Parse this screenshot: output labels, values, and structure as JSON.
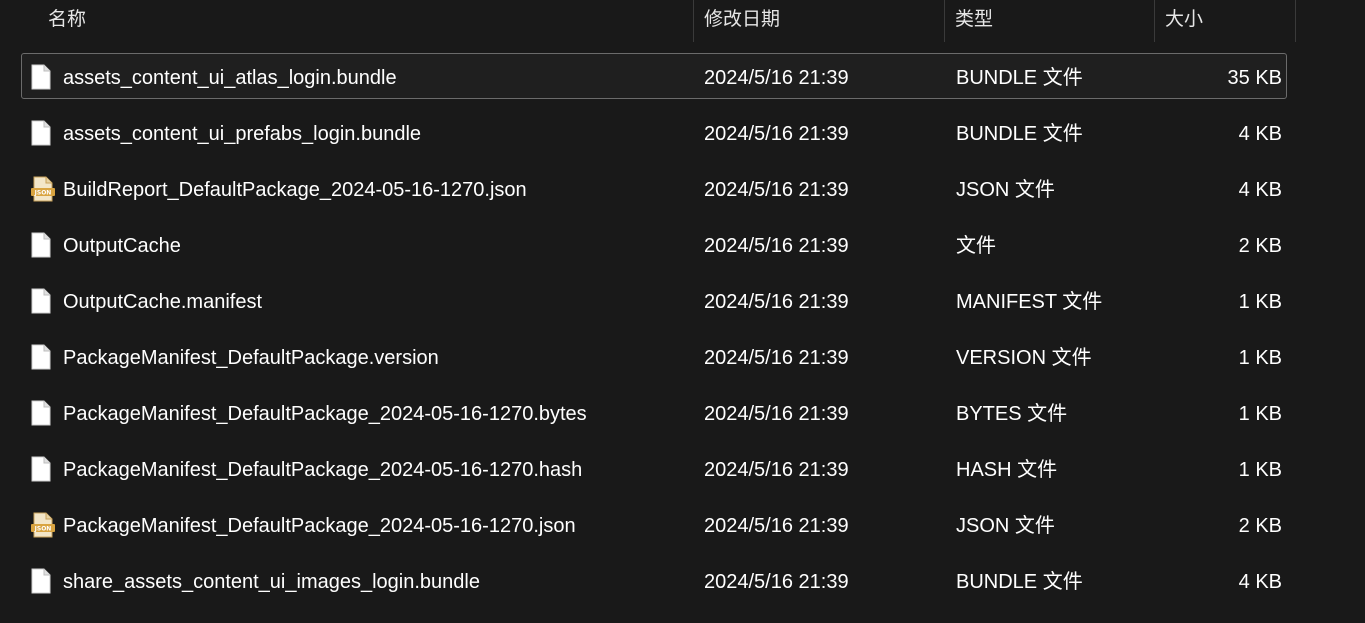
{
  "columns": {
    "name": "名称",
    "date": "修改日期",
    "type": "类型",
    "size": "大小"
  },
  "sort_indicator": "^",
  "files": [
    {
      "name": "assets_content_ui_atlas_login.bundle",
      "date": "2024/5/16 21:39",
      "type": "BUNDLE 文件",
      "size": "35 KB",
      "icon": "generic-file-icon"
    },
    {
      "name": "assets_content_ui_prefabs_login.bundle",
      "date": "2024/5/16 21:39",
      "type": "BUNDLE 文件",
      "size": "4 KB",
      "icon": "generic-file-icon"
    },
    {
      "name": "BuildReport_DefaultPackage_2024-05-16-1270.json",
      "date": "2024/5/16 21:39",
      "type": "JSON 文件",
      "size": "4 KB",
      "icon": "json-file-icon"
    },
    {
      "name": "OutputCache",
      "date": "2024/5/16 21:39",
      "type": "文件",
      "size": "2 KB",
      "icon": "generic-file-icon"
    },
    {
      "name": "OutputCache.manifest",
      "date": "2024/5/16 21:39",
      "type": "MANIFEST 文件",
      "size": "1 KB",
      "icon": "generic-file-icon"
    },
    {
      "name": "PackageManifest_DefaultPackage.version",
      "date": "2024/5/16 21:39",
      "type": "VERSION 文件",
      "size": "1 KB",
      "icon": "generic-file-icon"
    },
    {
      "name": "PackageManifest_DefaultPackage_2024-05-16-1270.bytes",
      "date": "2024/5/16 21:39",
      "type": "BYTES 文件",
      "size": "1 KB",
      "icon": "generic-file-icon"
    },
    {
      "name": "PackageManifest_DefaultPackage_2024-05-16-1270.hash",
      "date": "2024/5/16 21:39",
      "type": "HASH 文件",
      "size": "1 KB",
      "icon": "generic-file-icon"
    },
    {
      "name": "PackageManifest_DefaultPackage_2024-05-16-1270.json",
      "date": "2024/5/16 21:39",
      "type": "JSON 文件",
      "size": "2 KB",
      "icon": "json-file-icon"
    },
    {
      "name": "share_assets_content_ui_images_login.bundle",
      "date": "2024/5/16 21:39",
      "type": "BUNDLE 文件",
      "size": "4 KB",
      "icon": "generic-file-icon"
    }
  ],
  "json_icon_text": "JSON",
  "colors": {
    "background": "#191919",
    "selection_border": "#6b6b6b",
    "json_icon": "#d9a441"
  }
}
